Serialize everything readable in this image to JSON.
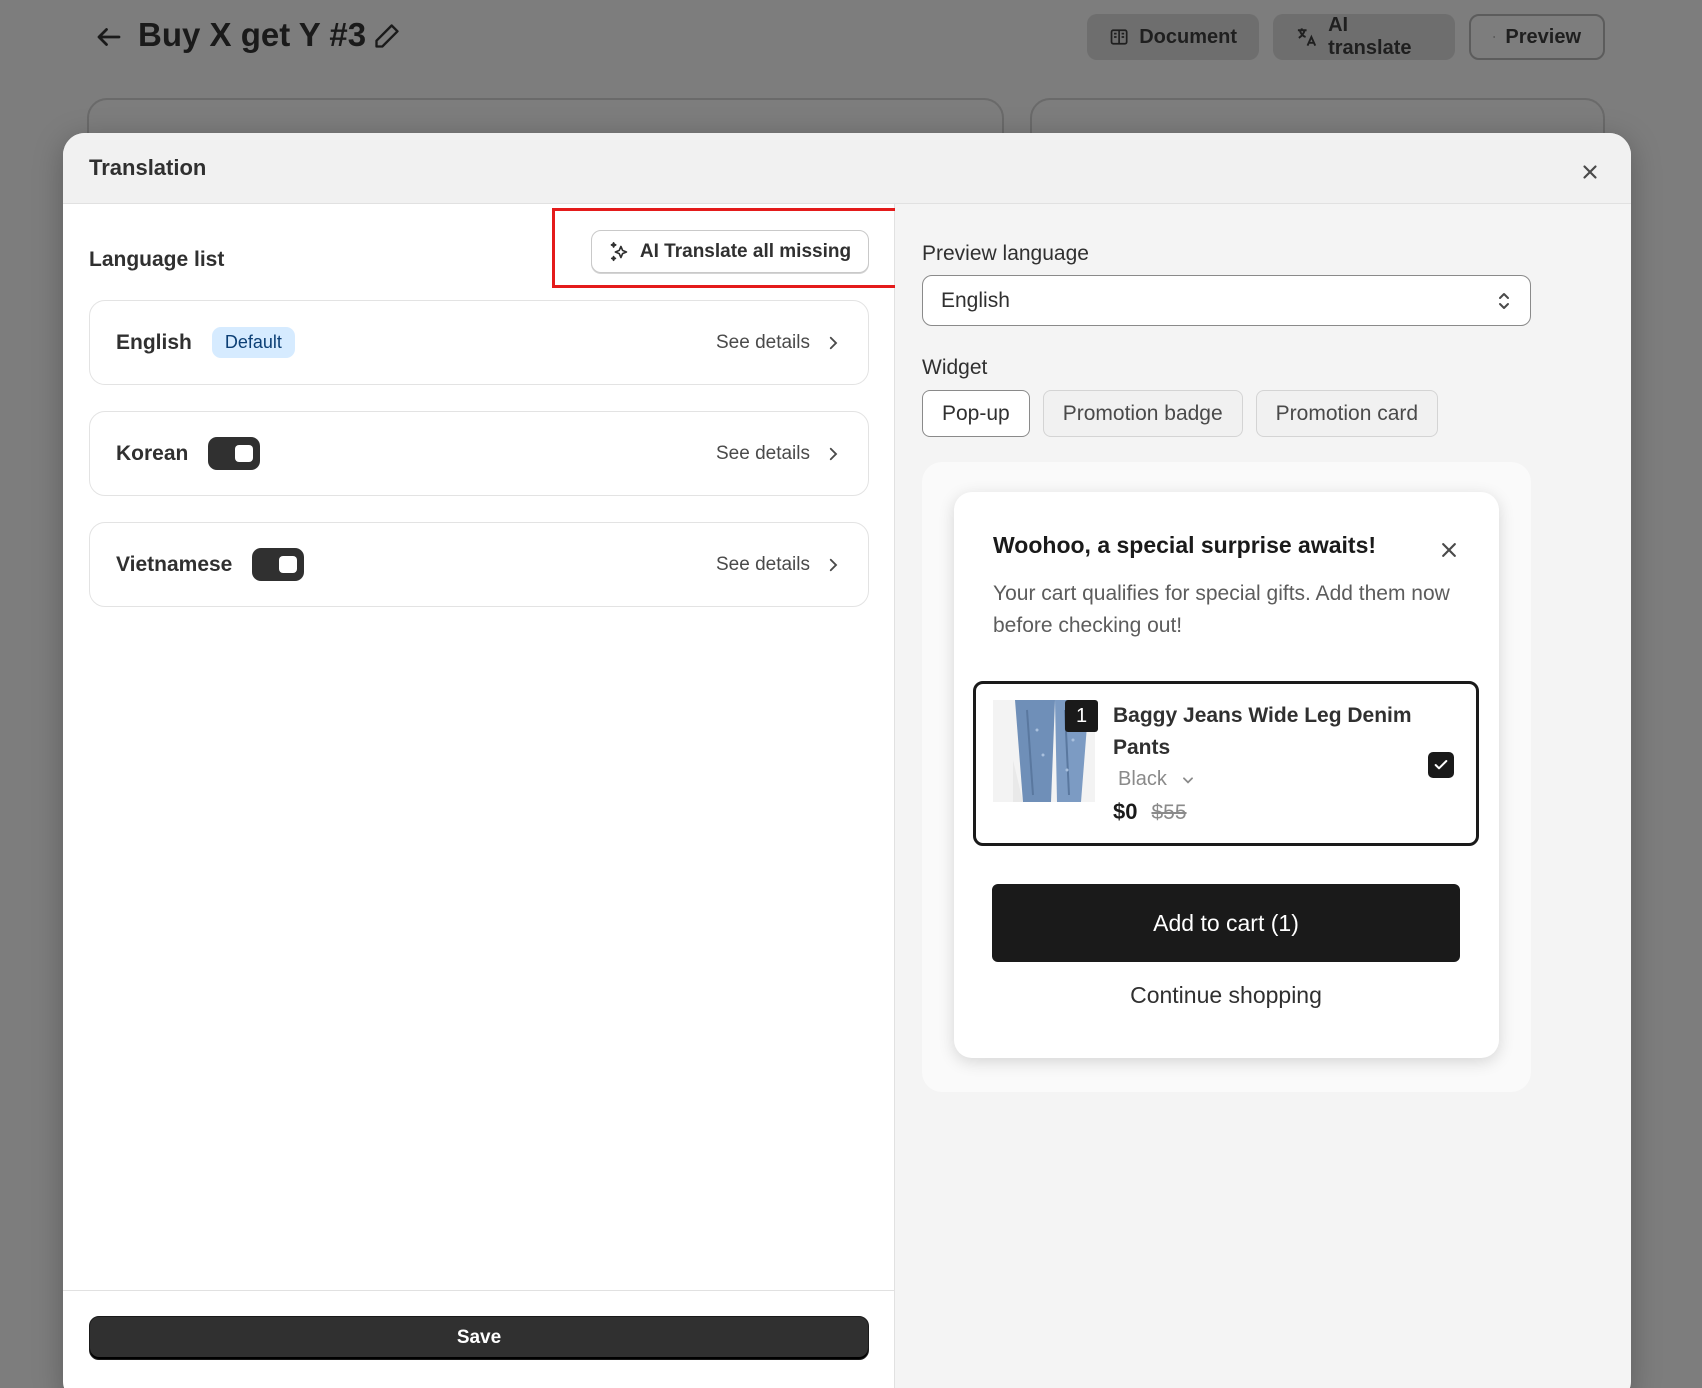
{
  "background": {
    "title": "Buy X get Y #3",
    "buttons": [
      {
        "label": "Document",
        "icon": "book-icon"
      },
      {
        "label": "AI translate",
        "icon": "translate-icon"
      },
      {
        "label": "Preview",
        "icon": "eye-icon"
      }
    ]
  },
  "modal": {
    "title": "Translation",
    "left": {
      "language_list_label": "Language list",
      "ai_translate_all_label": "AI Translate all missing",
      "languages": [
        {
          "name": "English",
          "badge": "Default",
          "details": "See details"
        },
        {
          "name": "Korean",
          "toggle": true,
          "details": "See details"
        },
        {
          "name": "Vietnamese",
          "toggle": true,
          "details": "See details"
        }
      ],
      "save_label": "Save"
    },
    "right": {
      "preview_language_label": "Preview language",
      "preview_language_value": "English",
      "widget_label": "Widget",
      "widget_tabs": [
        "Pop-up",
        "Promotion badge",
        "Promotion card"
      ],
      "active_tab": "Pop-up",
      "popup": {
        "title": "Woohoo, a special surprise awaits!",
        "description": "Your cart qualifies for special gifts. Add them now before checking out!",
        "product": {
          "quantity": "1",
          "name": "Baggy Jeans Wide Leg Denim Pants",
          "variant": "Black",
          "price_now": "$0",
          "price_old": "$55",
          "checked": true
        },
        "add_to_cart_label": "Add to cart (1)",
        "continue_label": "Continue shopping"
      }
    }
  },
  "colors": {
    "highlight": "#e41b1b",
    "primary": "#303030",
    "badge_bg": "#d6ebff"
  }
}
